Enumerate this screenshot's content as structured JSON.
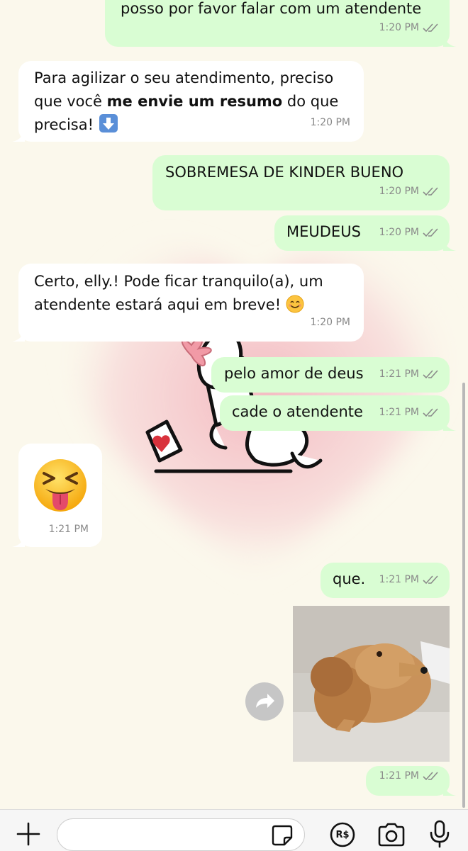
{
  "chat": {
    "messages": [
      {
        "direction": "outgoing",
        "text": "posso por favor falar com um atendente",
        "time": "1:20 PM",
        "status": "read"
      },
      {
        "direction": "incoming",
        "line1": "Para agilizar o seu atendimento, preciso",
        "line2_pre": "que você ",
        "line2_bold": "me envie um resumo",
        "line2_post": " do que",
        "line3": "precisa! ",
        "emoji": "down-arrow-emoji",
        "time": "1:20 PM"
      },
      {
        "direction": "outgoing",
        "text": "SOBREMESA DE KINDER BUENO",
        "time": "1:20 PM",
        "status": "read"
      },
      {
        "direction": "outgoing",
        "text": "MEUDEUS",
        "time": "1:20 PM",
        "status": "read"
      },
      {
        "direction": "incoming",
        "line1": "Certo, elly.! Pode ficar tranquilo(a), um",
        "line2": "atendente estará aqui em breve! ",
        "emoji": "smiling-face-emoji",
        "time": "1:20 PM"
      },
      {
        "direction": "outgoing",
        "text": "pelo amor de deus",
        "time": "1:21 PM",
        "status": "read"
      },
      {
        "direction": "outgoing",
        "text": "cade o atendente",
        "time": "1:21 PM",
        "status": "read"
      },
      {
        "direction": "incoming",
        "type": "emoji",
        "emoji": "squinting-face-with-tongue-emoji",
        "time": "1:21 PM"
      },
      {
        "direction": "outgoing",
        "text": "que.",
        "time": "1:21 PM",
        "status": "read"
      },
      {
        "direction": "outgoing",
        "type": "image",
        "image": "dachshund-dog-photo",
        "time": "1:21 PM",
        "status": "read"
      }
    ]
  },
  "colors": {
    "outgoing_bubble": "#d9fdd3",
    "incoming_bubble": "#ffffff",
    "background": "#fbf8ec",
    "read_ticks": "#8a8a8a"
  },
  "input_bar": {
    "icons": [
      "plus-icon",
      "sticker-icon",
      "pix-payment-icon",
      "camera-icon",
      "microphone-icon"
    ],
    "placeholder": "",
    "payment_symbol": "R$"
  }
}
